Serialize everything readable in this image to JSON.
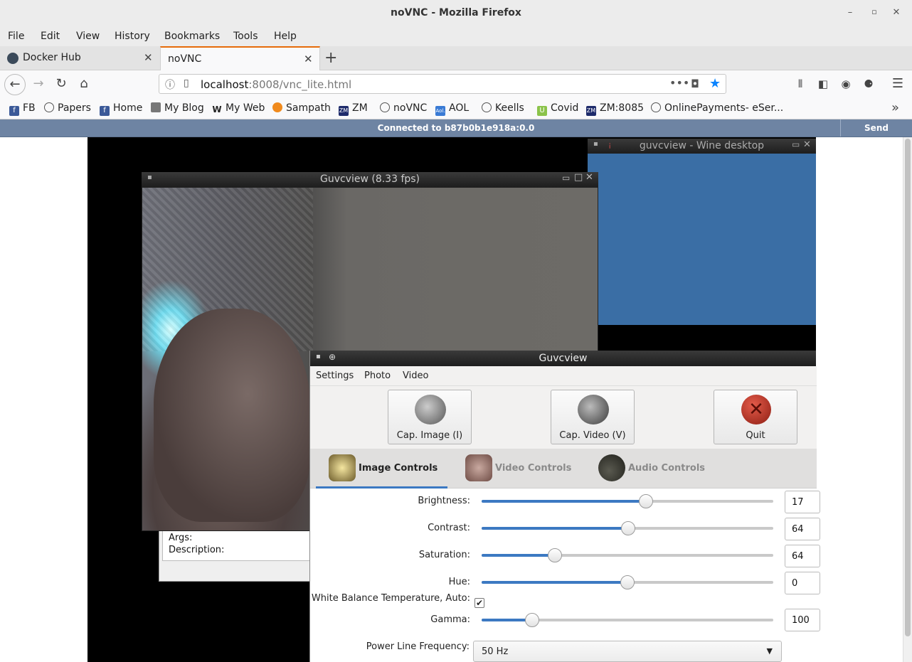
{
  "window": {
    "title": "noVNC - Mozilla Firefox"
  },
  "menu": [
    "File",
    "Edit",
    "View",
    "History",
    "Bookmarks",
    "Tools",
    "Help"
  ],
  "tabs": [
    {
      "label": "Docker Hub",
      "icon": "docker-icon"
    },
    {
      "label": "noVNC",
      "icon": ""
    }
  ],
  "url": {
    "host": "localhost",
    "rest": ":8008/vnc_lite.html"
  },
  "bookmarks": [
    {
      "label": "FB",
      "icon": "facebook-icon"
    },
    {
      "label": "Papers",
      "icon": "globe-icon"
    },
    {
      "label": "Home",
      "icon": "facebook-icon"
    },
    {
      "label": "My Blog",
      "icon": "blog-icon"
    },
    {
      "label": "My Web",
      "icon": "wix-icon"
    },
    {
      "label": "Sampath",
      "icon": "sampath-icon"
    },
    {
      "label": "ZM",
      "icon": "zm-icon"
    },
    {
      "label": "noVNC",
      "icon": "globe-icon"
    },
    {
      "label": "AOL",
      "icon": "aol-icon"
    },
    {
      "label": "Keells",
      "icon": "globe-icon"
    },
    {
      "label": "Covid",
      "icon": "covid-icon"
    },
    {
      "label": "ZM:8085",
      "icon": "zm-icon"
    },
    {
      "label": "OnlinePayments- eSer...",
      "icon": "globe-icon"
    }
  ],
  "vnc": {
    "status": "Connected to b87b0b1e918a:0.0",
    "cad": "Send CtrlAltDel"
  },
  "wine": {
    "title": "guvcview - Wine desktop"
  },
  "preview": {
    "title": "Guvcview  (8.33 fps)"
  },
  "bgwin": {
    "args": "Args:",
    "description": "Description:"
  },
  "controls": {
    "title": "Guvcview",
    "menu": [
      "Settings",
      "Photo",
      "Video"
    ],
    "buttons": {
      "cap_image": "Cap. Image (I)",
      "cap_video": "Cap. Video (V)",
      "quit": "Quit"
    },
    "tabs": {
      "image": "Image Controls",
      "video": "Video Controls",
      "audio": "Audio Controls"
    },
    "sliders": [
      {
        "label": "Brightness:",
        "value": "17",
        "level": 0.563
      },
      {
        "label": "Contrast:",
        "value": "64",
        "level": 0.503
      },
      {
        "label": "Saturation:",
        "value": "64",
        "level": 0.25
      },
      {
        "label": "Hue:",
        "value": "0",
        "level": 0.5
      }
    ],
    "wb_label": "White Balance Temperature, Auto:",
    "wb_checked": true,
    "gamma": {
      "label": "Gamma:",
      "value": "100",
      "level": 0.173
    },
    "plf": {
      "label": "Power Line Frequency:",
      "value": "50 Hz"
    }
  },
  "colors": {
    "accent": "#3c79c2",
    "vnc_bar": "#6e84a3",
    "wine_desktop": "#3a6ea5",
    "tab_accent": "#e66b0a"
  }
}
